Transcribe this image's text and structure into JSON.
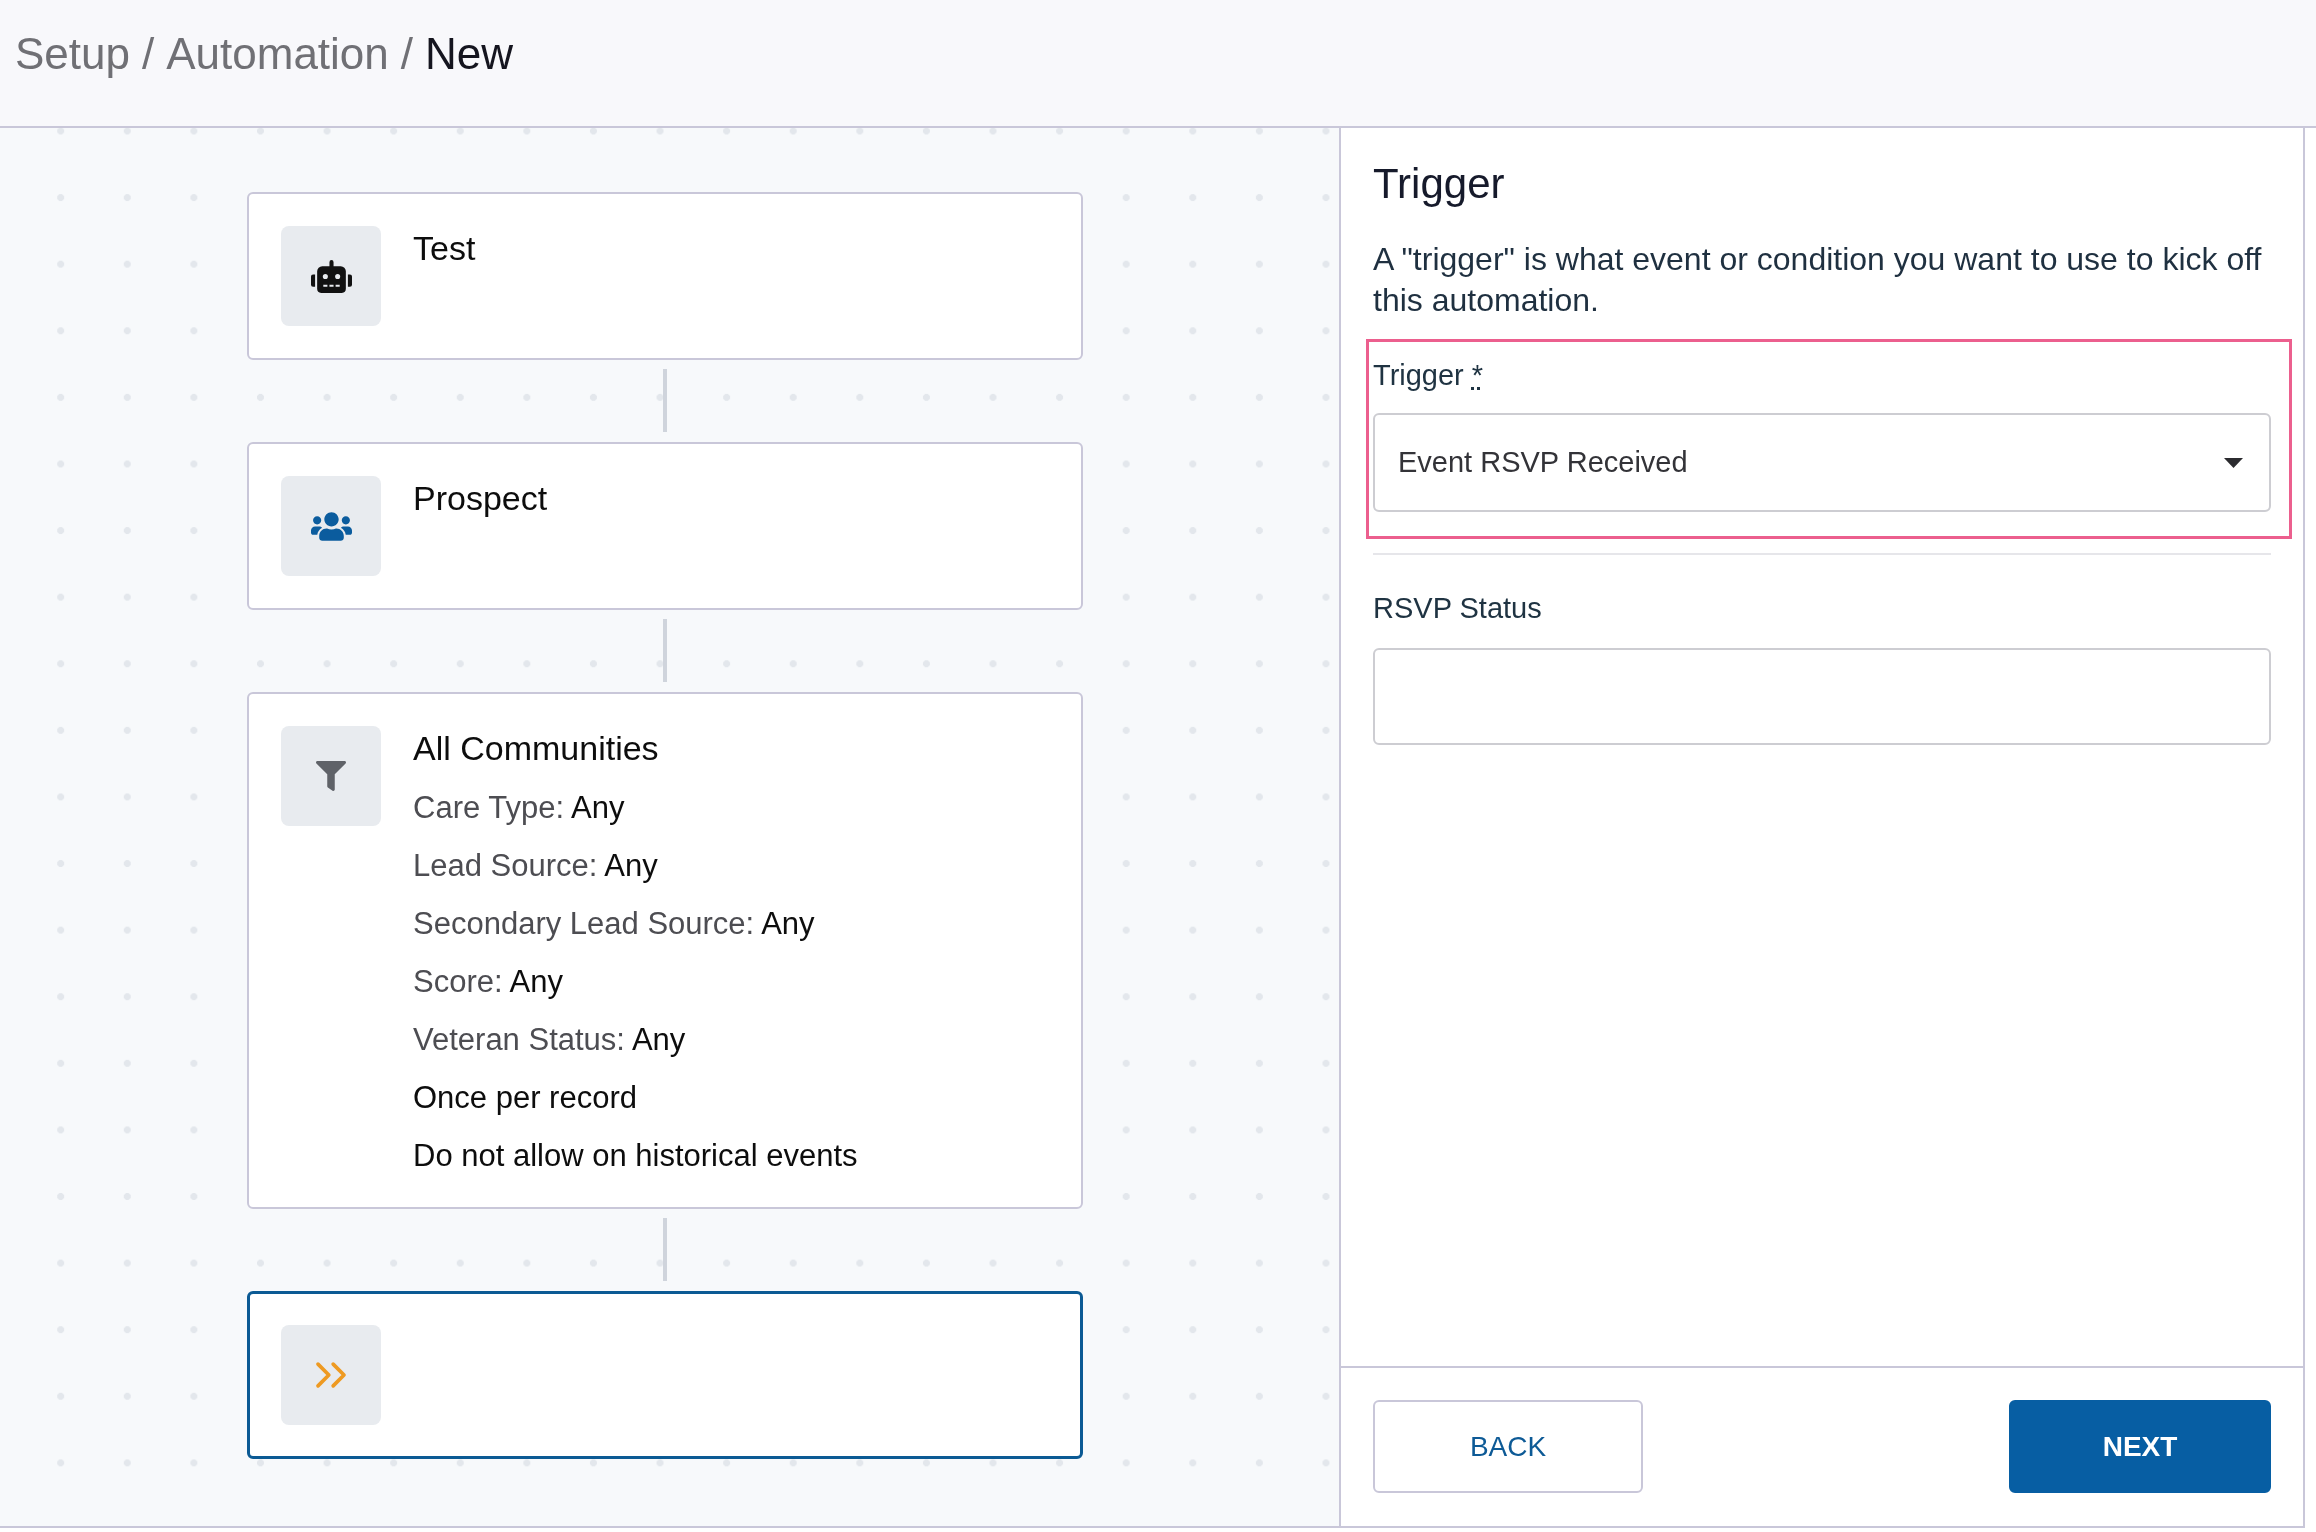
{
  "breadcrumb": [
    {
      "label": "Setup",
      "current": false,
      "separator": "/"
    },
    {
      "label": "Automation",
      "current": false,
      "separator": "/"
    },
    {
      "label": "New",
      "current": true
    }
  ],
  "flow": {
    "nodes": [
      {
        "kind": "trigger",
        "title": "Test",
        "selected": false
      },
      {
        "kind": "audience",
        "title": "Prospect",
        "selected": false
      },
      {
        "kind": "filter",
        "title": "All Communities",
        "selected": false,
        "lines": [
          {
            "kind": "criterion",
            "label": "Care Type:",
            "value": "Any"
          },
          {
            "kind": "criterion",
            "label": "Lead Source:",
            "value": "Any"
          },
          {
            "kind": "criterion",
            "label": "Secondary Lead Source:",
            "value": "Any"
          },
          {
            "kind": "criterion",
            "label": "Score:",
            "value": "Any"
          },
          {
            "kind": "criterion",
            "label": "Veteran Status:",
            "value": "Any"
          },
          {
            "kind": "option",
            "text": "Once per record"
          },
          {
            "kind": "option",
            "text": "Do not allow on historical events"
          }
        ]
      },
      {
        "kind": "action",
        "selected": true
      }
    ]
  },
  "panel": {
    "title": "Trigger",
    "description": "A \"trigger\" is what event or condition you want to use to kick off this automation.",
    "fields": [
      {
        "kind": "select",
        "label": "Trigger",
        "required_mark": "*",
        "value": "Event RSVP Received",
        "highlighted": true
      },
      {
        "kind": "text",
        "label": "RSVP Status",
        "highlighted": false
      }
    ],
    "buttons": [
      {
        "kind": "back",
        "label": "BACK"
      },
      {
        "kind": "next",
        "label": "NEXT"
      }
    ]
  }
}
